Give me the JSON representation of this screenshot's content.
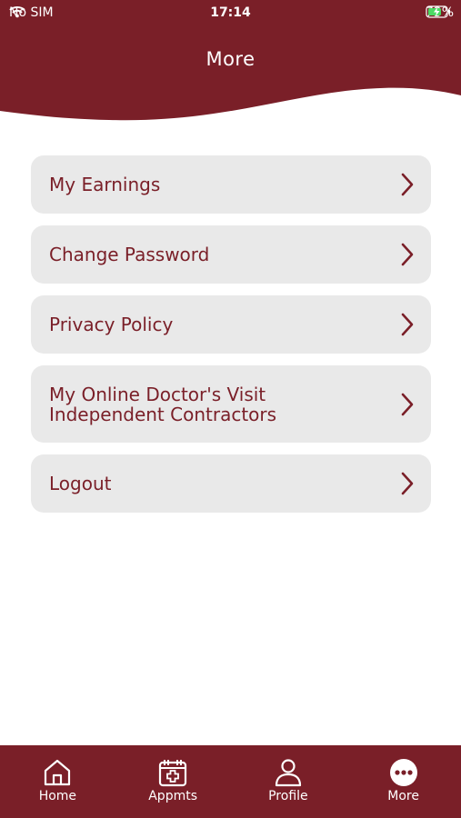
{
  "colors": {
    "brand": "#7a1f28",
    "item_bg": "#e9e9e9",
    "white": "#ffffff",
    "battery_green": "#4cd964"
  },
  "status_bar": {
    "carrier": "No SIM",
    "time": "17:14",
    "battery": "73%"
  },
  "header": {
    "title": "More"
  },
  "menu": {
    "items": [
      {
        "label": "My Earnings"
      },
      {
        "label": "Change Password"
      },
      {
        "label": "Privacy Policy"
      },
      {
        "label_line1": "My Online Doctor's Visit",
        "label_line2": "Independent Contractors"
      },
      {
        "label": "Logout"
      }
    ]
  },
  "tabbar": {
    "tabs": [
      {
        "label": "Home",
        "icon": "home-icon"
      },
      {
        "label": "Appmts",
        "icon": "calendar-plus-icon"
      },
      {
        "label": "Profile",
        "icon": "person-icon"
      },
      {
        "label": "More",
        "icon": "more-dots-icon",
        "active": true
      }
    ]
  }
}
